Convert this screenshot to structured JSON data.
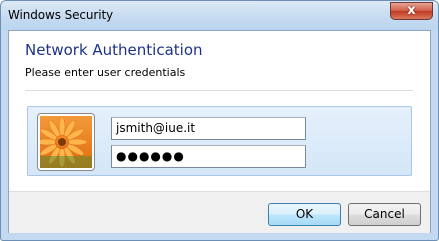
{
  "window": {
    "title": "Windows Security",
    "close_glyph": "x"
  },
  "dialog": {
    "heading": "Network Authentication",
    "subheading": "Please enter user credentials"
  },
  "credentials": {
    "avatar_icon": "flower-user-icon",
    "username_value": "jsmith@iue.it",
    "password_value": "●●●●●●"
  },
  "buttons": {
    "ok_label": "OK",
    "cancel_label": "Cancel"
  },
  "colors": {
    "heading": "#1e3287",
    "frame": "#c2d9f1",
    "tile": "#dceaf9",
    "close_button": "#c9503b"
  }
}
